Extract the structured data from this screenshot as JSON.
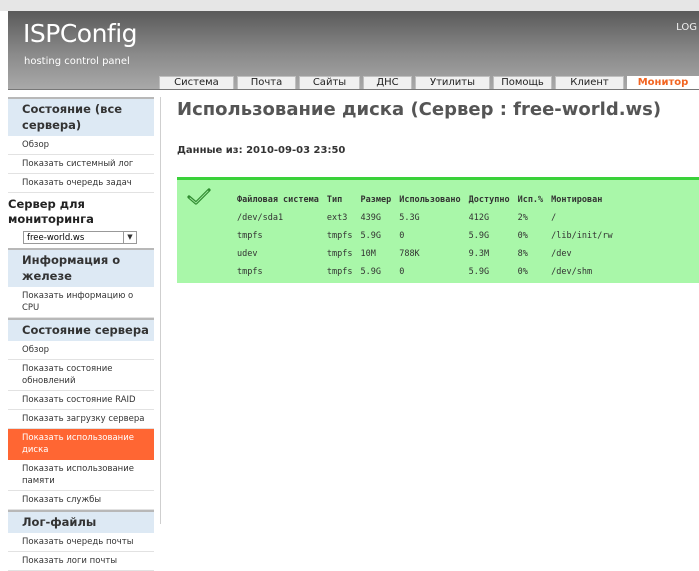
{
  "header": {
    "logo": "ISPConfig",
    "tagline": "hosting control panel",
    "logout": "LOG"
  },
  "nav": {
    "tabs": [
      {
        "label": "Система",
        "width": 73
      },
      {
        "label": "Почта",
        "width": 57
      },
      {
        "label": "Сайты",
        "width": 59
      },
      {
        "label": "ДНС",
        "width": 47
      },
      {
        "label": "Утилиты",
        "width": 73
      },
      {
        "label": "Помощь",
        "width": 57
      },
      {
        "label": "Клиент",
        "width": 67
      },
      {
        "label": "Монитор",
        "width": 70
      }
    ],
    "active_index": 7
  },
  "sidebar": {
    "status_section": "Состояние (все сервера)",
    "status_items": [
      "Обзор",
      "Показать системный лог",
      "Показать очередь задач"
    ],
    "server_label": "Сервер для мониторинга",
    "server_select": "free-world.ws",
    "hw_section": "Информация о железе",
    "hw_items": [
      "Показать информацию о CPU"
    ],
    "srv_section": "Состояние сервера",
    "srv_items": [
      "Обзор",
      "Показать состояние обновлений",
      "Показать состояние RAID",
      "Показать загрузку сервера",
      "Показать использование диска",
      "Показать использование памяти",
      "Показать службы"
    ],
    "srv_active_index": 4,
    "log_section": "Лог-файлы",
    "log_items": [
      "Показать очередь почты",
      "Показать логи почты"
    ]
  },
  "main": {
    "title": "Использование диска (Сервер : free-world.ws)",
    "date_label": "Данные из: 2010-09-03 23:50",
    "status_color": "#3ad13a",
    "table": {
      "headers": [
        "Файловая система",
        "Тип",
        "Размер",
        "Использовано",
        "Доступно",
        "Исп.%",
        "Монтирован"
      ],
      "rows": [
        [
          "/dev/sda1",
          "ext3",
          "439G",
          "5.3G",
          "412G",
          "2%",
          "/"
        ],
        [
          "tmpfs",
          "tmpfs",
          "5.9G",
          "0",
          "5.9G",
          "0%",
          "/lib/init/rw"
        ],
        [
          "udev",
          "tmpfs",
          "10M",
          "788K",
          "9.3M",
          "8%",
          "/dev"
        ],
        [
          "tmpfs",
          "tmpfs",
          "5.9G",
          "0",
          "5.9G",
          "0%",
          "/dev/shm"
        ]
      ]
    }
  }
}
